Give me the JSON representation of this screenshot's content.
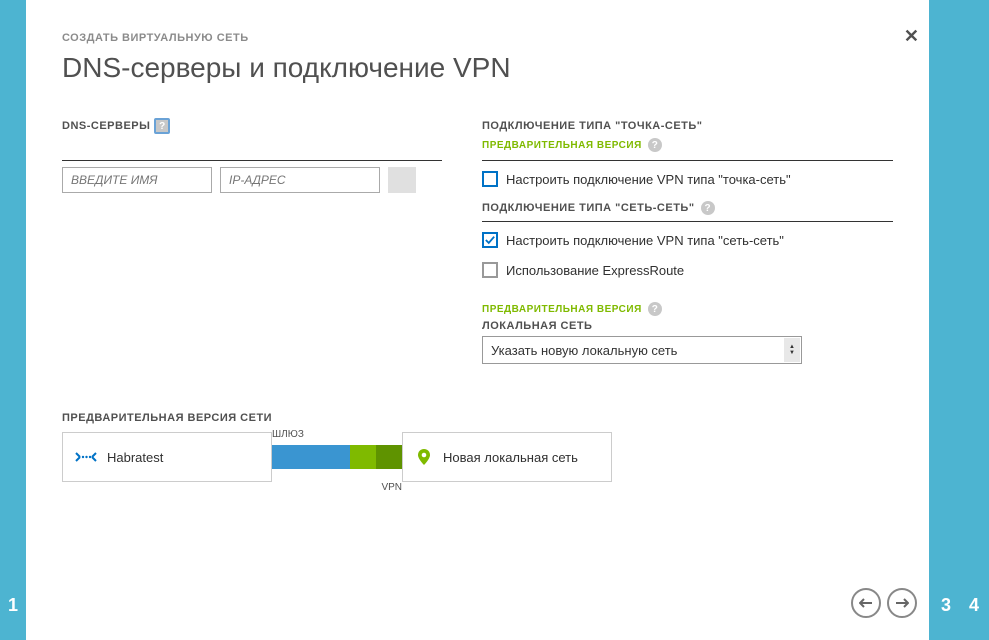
{
  "breadcrumb": "СОЗДАТЬ ВИРТУАЛЬНУЮ СЕТЬ",
  "title": "DNS-серверы и подключение VPN",
  "dns": {
    "label": "DNS-СЕРВЕРЫ",
    "name_placeholder": "ВВЕДИТЕ ИМЯ",
    "ip_placeholder": "IP-АДРЕС"
  },
  "point_to_site": {
    "label": "ПОДКЛЮЧЕНИЕ ТИПА \"ТОЧКА-СЕТЬ\"",
    "preview": "ПРЕДВАРИТЕЛЬНАЯ ВЕРСИЯ",
    "checkbox": "Настроить подключение VPN типа \"точка-сеть\""
  },
  "site_to_site": {
    "label": "ПОДКЛЮЧЕНИЕ ТИПА \"СЕТЬ-СЕТЬ\"",
    "checkbox": "Настроить подключение VPN типа \"сеть-сеть\"",
    "express_route": "Использование ExpressRoute",
    "preview": "ПРЕДВАРИТЕЛЬНАЯ ВЕРСИЯ",
    "local_net_label": "ЛОКАЛЬНАЯ СЕТЬ",
    "local_net_selected": "Указать новую локальную сеть"
  },
  "preview_net": {
    "label": "ПРЕДВАРИТЕЛЬНАЯ ВЕРСИЯ СЕТИ",
    "vnet_name": "Habratest",
    "gateway_label": "ШЛЮЗ",
    "vpn_label": "VPN",
    "local_label": "Новая локальная сеть"
  },
  "steps": {
    "left": "1",
    "right3": "3",
    "right4": "4"
  }
}
